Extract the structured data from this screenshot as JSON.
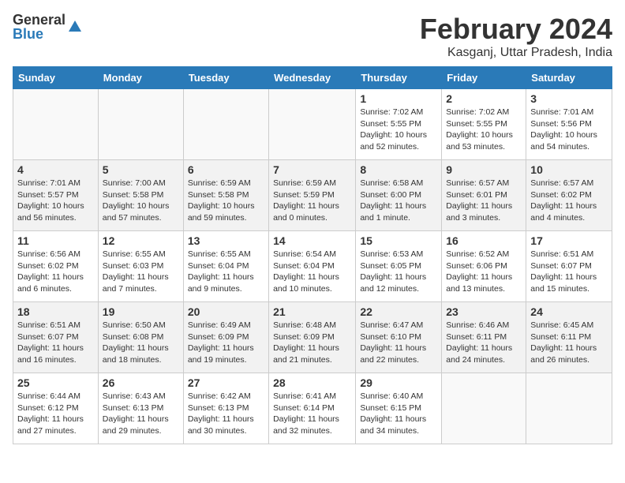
{
  "logo": {
    "general": "General",
    "blue": "Blue"
  },
  "title": "February 2024",
  "location": "Kasganj, Uttar Pradesh, India",
  "days_of_week": [
    "Sunday",
    "Monday",
    "Tuesday",
    "Wednesday",
    "Thursday",
    "Friday",
    "Saturday"
  ],
  "weeks": [
    [
      {
        "day": "",
        "empty": true
      },
      {
        "day": "",
        "empty": true
      },
      {
        "day": "",
        "empty": true
      },
      {
        "day": "",
        "empty": true
      },
      {
        "day": "1",
        "sunrise": "7:02 AM",
        "sunset": "5:55 PM",
        "daylight": "10 hours and 52 minutes."
      },
      {
        "day": "2",
        "sunrise": "7:02 AM",
        "sunset": "5:55 PM",
        "daylight": "10 hours and 53 minutes."
      },
      {
        "day": "3",
        "sunrise": "7:01 AM",
        "sunset": "5:56 PM",
        "daylight": "10 hours and 54 minutes."
      }
    ],
    [
      {
        "day": "4",
        "sunrise": "7:01 AM",
        "sunset": "5:57 PM",
        "daylight": "10 hours and 56 minutes."
      },
      {
        "day": "5",
        "sunrise": "7:00 AM",
        "sunset": "5:58 PM",
        "daylight": "10 hours and 57 minutes."
      },
      {
        "day": "6",
        "sunrise": "6:59 AM",
        "sunset": "5:58 PM",
        "daylight": "10 hours and 59 minutes."
      },
      {
        "day": "7",
        "sunrise": "6:59 AM",
        "sunset": "5:59 PM",
        "daylight": "11 hours and 0 minutes."
      },
      {
        "day": "8",
        "sunrise": "6:58 AM",
        "sunset": "6:00 PM",
        "daylight": "11 hours and 1 minute."
      },
      {
        "day": "9",
        "sunrise": "6:57 AM",
        "sunset": "6:01 PM",
        "daylight": "11 hours and 3 minutes."
      },
      {
        "day": "10",
        "sunrise": "6:57 AM",
        "sunset": "6:02 PM",
        "daylight": "11 hours and 4 minutes."
      }
    ],
    [
      {
        "day": "11",
        "sunrise": "6:56 AM",
        "sunset": "6:02 PM",
        "daylight": "11 hours and 6 minutes."
      },
      {
        "day": "12",
        "sunrise": "6:55 AM",
        "sunset": "6:03 PM",
        "daylight": "11 hours and 7 minutes."
      },
      {
        "day": "13",
        "sunrise": "6:55 AM",
        "sunset": "6:04 PM",
        "daylight": "11 hours and 9 minutes."
      },
      {
        "day": "14",
        "sunrise": "6:54 AM",
        "sunset": "6:04 PM",
        "daylight": "11 hours and 10 minutes."
      },
      {
        "day": "15",
        "sunrise": "6:53 AM",
        "sunset": "6:05 PM",
        "daylight": "11 hours and 12 minutes."
      },
      {
        "day": "16",
        "sunrise": "6:52 AM",
        "sunset": "6:06 PM",
        "daylight": "11 hours and 13 minutes."
      },
      {
        "day": "17",
        "sunrise": "6:51 AM",
        "sunset": "6:07 PM",
        "daylight": "11 hours and 15 minutes."
      }
    ],
    [
      {
        "day": "18",
        "sunrise": "6:51 AM",
        "sunset": "6:07 PM",
        "daylight": "11 hours and 16 minutes."
      },
      {
        "day": "19",
        "sunrise": "6:50 AM",
        "sunset": "6:08 PM",
        "daylight": "11 hours and 18 minutes."
      },
      {
        "day": "20",
        "sunrise": "6:49 AM",
        "sunset": "6:09 PM",
        "daylight": "11 hours and 19 minutes."
      },
      {
        "day": "21",
        "sunrise": "6:48 AM",
        "sunset": "6:09 PM",
        "daylight": "11 hours and 21 minutes."
      },
      {
        "day": "22",
        "sunrise": "6:47 AM",
        "sunset": "6:10 PM",
        "daylight": "11 hours and 22 minutes."
      },
      {
        "day": "23",
        "sunrise": "6:46 AM",
        "sunset": "6:11 PM",
        "daylight": "11 hours and 24 minutes."
      },
      {
        "day": "24",
        "sunrise": "6:45 AM",
        "sunset": "6:11 PM",
        "daylight": "11 hours and 26 minutes."
      }
    ],
    [
      {
        "day": "25",
        "sunrise": "6:44 AM",
        "sunset": "6:12 PM",
        "daylight": "11 hours and 27 minutes."
      },
      {
        "day": "26",
        "sunrise": "6:43 AM",
        "sunset": "6:13 PM",
        "daylight": "11 hours and 29 minutes."
      },
      {
        "day": "27",
        "sunrise": "6:42 AM",
        "sunset": "6:13 PM",
        "daylight": "11 hours and 30 minutes."
      },
      {
        "day": "28",
        "sunrise": "6:41 AM",
        "sunset": "6:14 PM",
        "daylight": "11 hours and 32 minutes."
      },
      {
        "day": "29",
        "sunrise": "6:40 AM",
        "sunset": "6:15 PM",
        "daylight": "11 hours and 34 minutes."
      },
      {
        "day": "",
        "empty": true
      },
      {
        "day": "",
        "empty": true
      }
    ]
  ]
}
